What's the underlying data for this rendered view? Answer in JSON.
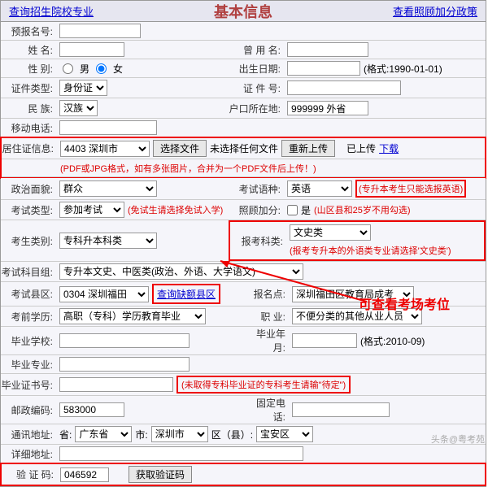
{
  "header": {
    "left_link": "查询招生院校专业",
    "title": "基本信息",
    "right_link": "查看照顾加分政策"
  },
  "rows": {
    "prereg": {
      "label": "预报名号:"
    },
    "name": {
      "label": "姓  名:",
      "alias_label": "曾 用 名:"
    },
    "gender": {
      "label": "性  别:",
      "male": "男",
      "female": "女",
      "birth_label": "出生日期:",
      "birth_hint": "(格式:1990-01-01)"
    },
    "idtype": {
      "label": "证件类型:",
      "value": "身份证",
      "idno_label": "证  件  号:"
    },
    "ethnic": {
      "label": "民  族:",
      "value": "汉族",
      "huko_label": "户口所在地:",
      "huko_value": "999999 外省"
    },
    "mobile": {
      "label": "移动电话:"
    },
    "residence": {
      "label": "居住证信息:",
      "select": "4403 深圳市",
      "btn_choose": "选择文件",
      "no_file": "未选择任何文件",
      "btn_reupload": "重新上传",
      "uploaded": "已上传",
      "download": "下载",
      "hint": "(PDF或JPG格式，如有多张图片，合并为一个PDF文件后上传！)"
    },
    "political": {
      "label": "政治面貌:",
      "value": "群众",
      "exam_lang_label": "考试语种:",
      "exam_lang_value": "英语",
      "exam_lang_hint": "(专升本考生只能选报英语)"
    },
    "examtype": {
      "label": "考试类型:",
      "value": "参加考试",
      "hint": "(免试生请选择免试入学)",
      "bonus_label": "照顾加分:",
      "bonus_cb": "是",
      "bonus_hint": "(山区县和25岁不用勾选)"
    },
    "candidate": {
      "label": "考生类别:",
      "value": "专科升本科类",
      "subject_label": "报考科类:",
      "subject_value": "文史类",
      "subject_hint": "(报考专升本的外语类专业请选择'文史类')"
    },
    "subjgroup": {
      "label": "考试科目组:",
      "value": "专升本文史、中医类(政治、外语、大学语文)"
    },
    "district": {
      "label": "考试县区:",
      "value": "0304 深圳福田",
      "query_btn": "查询缺额县区",
      "site_label": "报名点:",
      "site_value": "深圳福田区教育局成考"
    },
    "preedu": {
      "label": "考前学历:",
      "value": "高职（专科）学历教育毕业",
      "job_label": "职  业:",
      "job_value": "不便分类的其他从业人员"
    },
    "gradschool": {
      "label": "毕业学校:",
      "gradyear_label": "毕业年月:",
      "gradyear_hint": "(格式:2010-09)"
    },
    "gradmajor": {
      "label": "毕业专业:"
    },
    "gradcert": {
      "label": "毕业证书号:",
      "hint": "(未取得专科毕业证的专科考生请输\"待定\")"
    },
    "postal": {
      "label": "邮政编码:",
      "value": "583000",
      "tel_label": "固定电话:"
    },
    "addr": {
      "label": "通讯地址:",
      "prov": "广东省",
      "city": "深圳市",
      "dist_label": "区（县）:",
      "dist": "宝安区"
    },
    "addr2": {
      "label": "详细地址:"
    },
    "captcha": {
      "label": "验 证 码:",
      "value": "046592",
      "btn": "获取验证码"
    }
  },
  "annotations": {
    "seat": "可查看考场考位"
  },
  "watermark": "头条@粤考苑"
}
